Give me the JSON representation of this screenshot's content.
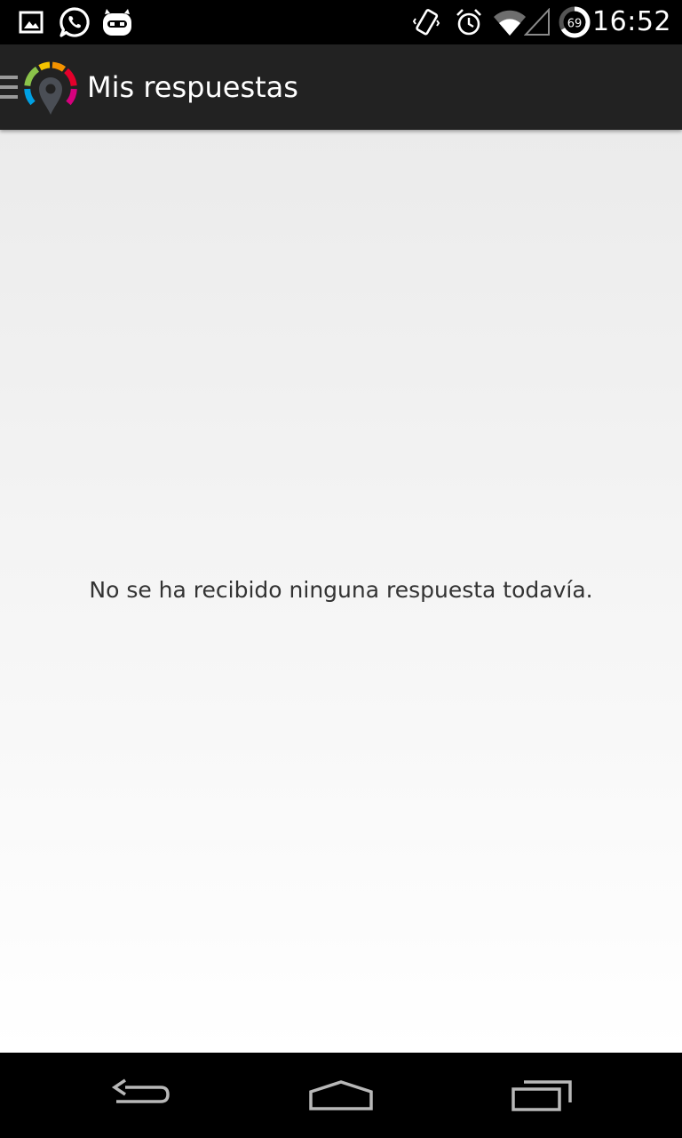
{
  "status_bar": {
    "time": "16:52",
    "battery_level": "69",
    "notification_icons": [
      "gallery-icon",
      "whatsapp-icon",
      "cyanogenmod-icon"
    ],
    "system_icons": [
      "vibrate-icon",
      "alarm-icon",
      "wifi-icon",
      "signal-icon",
      "battery-icon"
    ]
  },
  "action_bar": {
    "title": "Mis respuestas",
    "background": "#222222",
    "logo_colors": [
      "#8bc34a",
      "#f5c400",
      "#f39200",
      "#e4002b",
      "#d6007d",
      "#00a0e3"
    ]
  },
  "content": {
    "empty_message": "No se ha recibido ninguna respuesta todavía."
  },
  "nav_bar": {
    "buttons": [
      "back-icon",
      "home-icon",
      "recents-icon"
    ]
  }
}
